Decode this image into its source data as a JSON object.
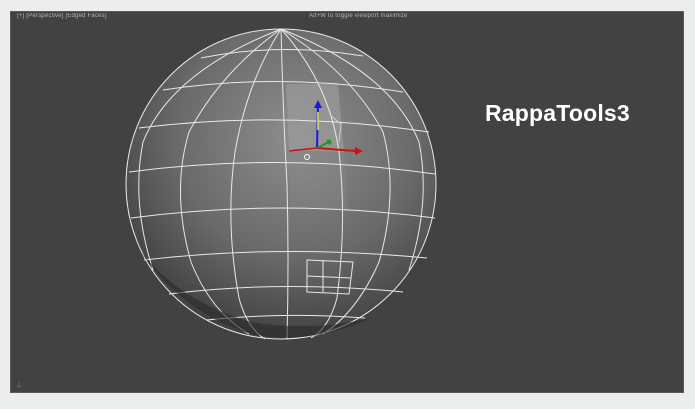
{
  "viewport": {
    "label_left": "[+] [Perspective] [Edged Faces]",
    "label_center": "Alt+W to toggle viewport maximize",
    "overlay_title": "RappaTools3",
    "corner_glyph": "⊥"
  },
  "scene": {
    "object": "sphere",
    "selected_faces": 1,
    "gizmo": "transform-gizmo"
  },
  "colors": {
    "viewport_bg": "#424242",
    "wire": "#ffffff",
    "selected_face": "#9c9c9c",
    "gizmo_x": "#d01010",
    "gizmo_y": "#1a9a1a",
    "gizmo_z": "#1818e0"
  }
}
